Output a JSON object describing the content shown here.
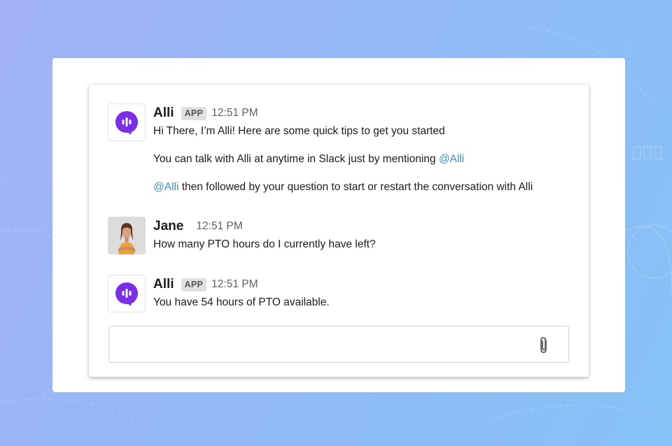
{
  "messages": [
    {
      "sender": "Alli",
      "badge": "APP",
      "time": "12:51 PM",
      "avatar_icon": "alli-logo-icon",
      "lines": {
        "l1": "Hi There, I’m Alli! Here are some quick tips to get you started",
        "l2_text": "You can talk with Alli at anytime in Slack just by mentioning ",
        "l2_mention": "@Alli",
        "l3_mention": "@Alli",
        "l3_text": " then followed by your question to start or restart the conversation with Alli"
      }
    },
    {
      "sender": "Jane",
      "time": "12:51 PM",
      "avatar_icon": "user-photo",
      "text": "How many PTO hours do I currently have left?"
    },
    {
      "sender": "Alli",
      "badge": "APP",
      "time": "12:51 PM",
      "avatar_icon": "alli-logo-icon",
      "text": "You have 54 hours of PTO available."
    }
  ],
  "composer": {
    "value": "",
    "placeholder": "",
    "attach_icon": "paperclip-icon"
  },
  "colors": {
    "brand_purple": "#7a2ee8",
    "mention": "#3a8fce",
    "background_start": "#a3b2f7",
    "background_end": "#86c2f5"
  }
}
